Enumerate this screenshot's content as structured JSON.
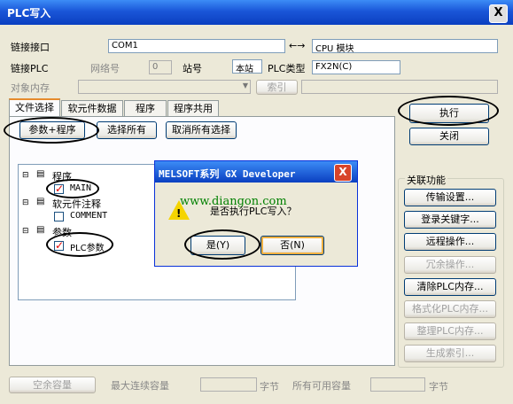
{
  "window": {
    "title": "PLC写入",
    "close_glyph": "X"
  },
  "connection": {
    "link_label": "链接接口",
    "link_value": "COM1",
    "arrow": "←→",
    "cpu_value": "CPU 模块",
    "plc_label": "链接PLC",
    "net_label": "网络号",
    "net_value": "0",
    "station_label": "站号",
    "station_value": "本站",
    "plc_type_label": "PLC类型",
    "plc_type_value": "FX2N(C)",
    "memory_label": "对象内存",
    "index_label": "索引"
  },
  "tabs": [
    "文件选择",
    "软元件数据",
    "程序",
    "程序共用"
  ],
  "file_buttons": {
    "param_program": "参数+程序",
    "select_all": "选择所有",
    "deselect_all": "取消所有选择"
  },
  "tree": {
    "program": "程序",
    "main": "MAIN",
    "device_comment": "软元件注释",
    "comment": "COMMENT",
    "param": "参数",
    "plc_param": "PLC参数"
  },
  "actions": {
    "execute": "执行",
    "close": "关闭"
  },
  "related": {
    "title": "关联功能",
    "buttons": [
      "传输设置...",
      "登录关键字...",
      "远程操作...",
      "冗余操作...",
      "清除PLC内存...",
      "格式化PLC内存...",
      "整理PLC内存...",
      "生成索引..."
    ]
  },
  "capacity": {
    "free_label": "空余容量",
    "max_label": "最大连续容量",
    "unit1": "字节",
    "all_label": "所有可用容量",
    "unit2": "字节"
  },
  "dialog": {
    "title": "MELSOFT系列 GX Developer",
    "watermark": "www.diangon.com",
    "message": "是否执行PLC写入？",
    "yes": "是(Y)",
    "no": "否(N)"
  }
}
